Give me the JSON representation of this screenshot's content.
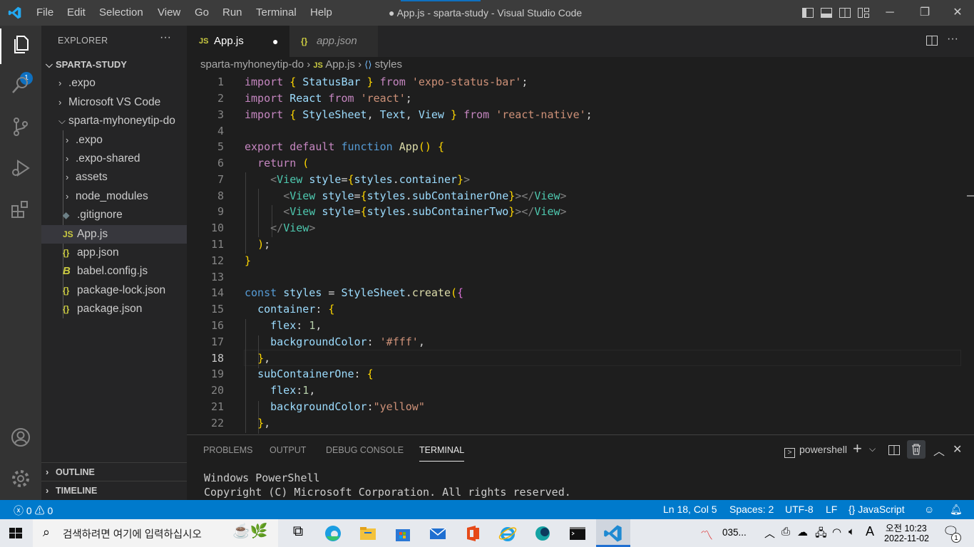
{
  "window": {
    "title": "● App.js - sparta-study - Visual Studio Code"
  },
  "menu": [
    "File",
    "Edit",
    "Selection",
    "View",
    "Go",
    "Run",
    "Terminal",
    "Help"
  ],
  "activity": {
    "badge": "1"
  },
  "sidebar": {
    "header": "EXPLORER",
    "more": "···",
    "root": "SPARTA-STUDY",
    "items": [
      {
        "label": ".expo",
        "type": "folder"
      },
      {
        "label": "Microsoft VS Code",
        "type": "folder"
      },
      {
        "label": "sparta-myhoneytip-do",
        "type": "folder-open"
      },
      {
        "label": ".expo",
        "type": "folder"
      },
      {
        "label": ".expo-shared",
        "type": "folder"
      },
      {
        "label": "assets",
        "type": "folder"
      },
      {
        "label": "node_modules",
        "type": "folder"
      },
      {
        "label": ".gitignore",
        "type": "file"
      },
      {
        "label": "App.js",
        "type": "js",
        "icon": "JS"
      },
      {
        "label": "app.json",
        "type": "json",
        "icon": "{}"
      },
      {
        "label": "babel.config.js",
        "type": "babel"
      },
      {
        "label": "package-lock.json",
        "type": "json",
        "icon": "{}"
      },
      {
        "label": "package.json",
        "type": "json",
        "icon": "{}"
      }
    ],
    "outline": "OUTLINE",
    "timeline": "TIMELINE"
  },
  "tabs": [
    {
      "label": "App.js",
      "icon": "JS",
      "active": true,
      "modified": true
    },
    {
      "label": "app.json",
      "icon": "{}",
      "active": false
    }
  ],
  "breadcrumb": {
    "folder": "sparta-myhoneytip-do",
    "file": "App.js",
    "icon": "JS",
    "symbol": "styles"
  },
  "code": {
    "line_numbers": [
      "1",
      "2",
      "3",
      "4",
      "5",
      "6",
      "7",
      "8",
      "9",
      "10",
      "11",
      "12",
      "13",
      "14",
      "15",
      "16",
      "17",
      "18",
      "19",
      "20",
      "21",
      "22"
    ],
    "current_line": "18",
    "lines": [
      "import { StatusBar } from 'expo-status-bar';",
      "import React from 'react';",
      "import { StyleSheet, Text, View } from 'react-native';",
      "",
      "export default function App() {",
      "  return (",
      "    <View style={styles.container}>",
      "      <View style={styles.subContainerOne}></View>",
      "      <View style={styles.subContainerTwo}></View>",
      "    </View>",
      "  );",
      "}",
      "",
      "const styles = StyleSheet.create({",
      "  container: {",
      "    flex: 1,",
      "    backgroundColor: '#fff',",
      "  },",
      "  subContainerOne: {",
      "    flex:1,",
      "    backgroundColor:\"yellow\"",
      "  },"
    ]
  },
  "panel": {
    "tabs": [
      "PROBLEMS",
      "OUTPUT",
      "DEBUG CONSOLE",
      "TERMINAL"
    ],
    "active_tab": "TERMINAL",
    "shell": "powershell",
    "terminal_lines": [
      "Windows PowerShell",
      "Copyright (C) Microsoft Corporation. All rights reserved."
    ]
  },
  "status": {
    "errors": "0",
    "warnings": "0",
    "position": "Ln 18, Col 5",
    "spaces": "Spaces: 2",
    "encoding": "UTF-8",
    "eol": "LF",
    "language": "JavaScript"
  },
  "taskbar": {
    "search_placeholder": "검색하려면 여기에 입력하십시오",
    "tray_app": "035...",
    "ime": "A",
    "time": "오전 10:23",
    "date": "2022-11-02",
    "notification_count": "1"
  },
  "colors": {
    "accent": "#007acc",
    "titlebar": "#3c3c3c",
    "sidebar": "#252526",
    "editor": "#1e1e1e"
  }
}
